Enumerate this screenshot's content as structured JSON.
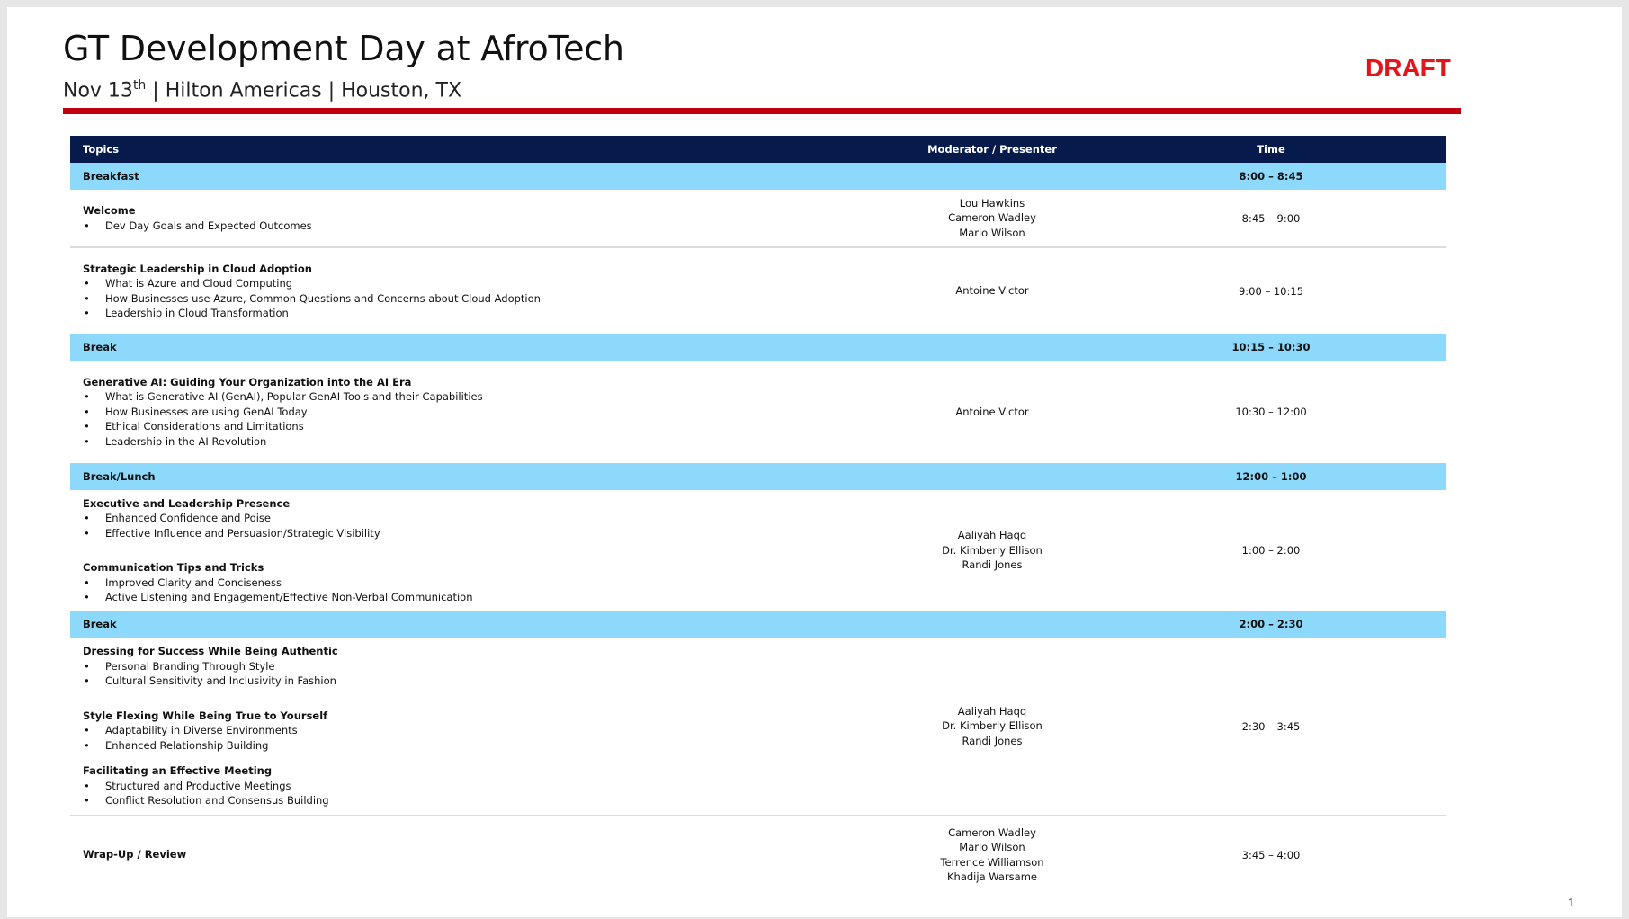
{
  "header": {
    "title": "GT Development Day at AfroTech",
    "date_prefix": "Nov 13",
    "date_suffix": "th",
    "location": " | Hilton Americas | Houston, TX",
    "status": "DRAFT"
  },
  "colors": {
    "header_row": "#061b4c",
    "break_row": "#8cd9fc",
    "accent_rule": "#c00010",
    "draft": "#e3151b"
  },
  "table": {
    "headers": {
      "topics": "Topics",
      "moderator": "Moderator / Presenter",
      "time": "Time"
    },
    "breakfast": {
      "label": "Breakfast",
      "time": "8:00 – 8:45"
    },
    "welcome": {
      "title": "Welcome",
      "bullets": [
        "Dev Day Goals and Expected Outcomes"
      ],
      "presenters": [
        "Lou Hawkins",
        "Cameron Wadley",
        "Marlo Wilson"
      ],
      "time": "8:45 – 9:00"
    },
    "strategic": {
      "title": "Strategic Leadership in Cloud Adoption",
      "bullets": [
        "What is Azure and Cloud Computing",
        "How Businesses use Azure, Common Questions and Concerns about Cloud Adoption",
        "Leadership in Cloud Transformation"
      ],
      "presenter": "Antoine Victor",
      "time": "9:00 – 10:15"
    },
    "break1": {
      "label": "Break",
      "time": "10:15 – 10:30"
    },
    "genai": {
      "title": "Generative AI: Guiding Your Organization into the AI Era",
      "bullets": [
        "What is Generative AI (GenAI), Popular GenAI Tools and their Capabilities",
        "How Businesses are using GenAI Today",
        "Ethical Considerations and Limitations",
        "Leadership in the AI Revolution"
      ],
      "presenter": "Antoine Victor",
      "time": "10:30 – 12:00"
    },
    "lunch": {
      "label": "Break/Lunch",
      "time": "12:00 – 1:00"
    },
    "exec": {
      "block1_title": "Executive and Leadership Presence",
      "block1_bullets": [
        "Enhanced Confidence and Poise",
        "Effective Influence and Persuasion/Strategic Visibility"
      ],
      "block2_title": "Communication Tips and Tricks",
      "block2_bullets": [
        "Improved Clarity and Conciseness",
        "Active Listening and Engagement/Effective Non-Verbal Communication"
      ],
      "presenters": [
        "Aaliyah Haqq",
        "Dr. Kimberly Ellison",
        "Randi Jones"
      ],
      "time": "1:00 – 2:00"
    },
    "break2": {
      "label": "Break",
      "time": "2:00 – 2:30"
    },
    "dressing": {
      "block1_title": "Dressing for Success While Being Authentic",
      "block1_bullets": [
        "Personal Branding Through Style",
        "Cultural Sensitivity and Inclusivity in Fashion"
      ],
      "block2_title": "Style Flexing While Being True to Yourself",
      "block2_bullets": [
        "Adaptability in Diverse Environments",
        "Enhanced Relationship Building"
      ],
      "block3_title": "Facilitating an Effective Meeting",
      "block3_bullets": [
        "Structured and Productive Meetings",
        "Conflict Resolution and Consensus Building"
      ],
      "presenters": [
        "Aaliyah Haqq",
        "Dr. Kimberly Ellison",
        "Randi Jones"
      ],
      "time": "2:30 – 3:45"
    },
    "wrapup": {
      "title": "Wrap-Up / Review",
      "presenters": [
        "Cameron Wadley",
        "Marlo Wilson",
        "Terrence Williamson",
        "Khadija Warsame"
      ],
      "time": "3:45 – 4:00"
    }
  },
  "footer": {
    "page_number": "1"
  }
}
